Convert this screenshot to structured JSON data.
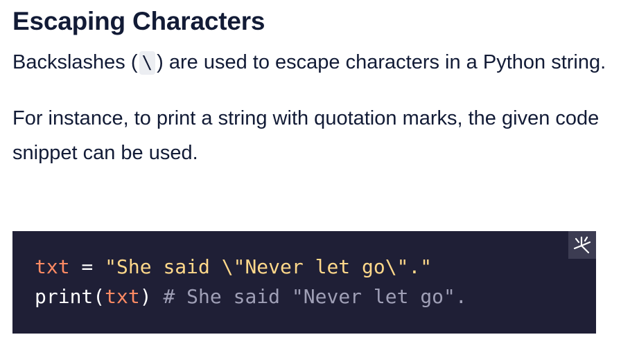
{
  "article": {
    "title": "Escaping Characters",
    "para1_before": "Backslashes (",
    "para1_code": "\\",
    "para1_after": ") are used to escape characters in a Python string.",
    "para2": "For instance, to print a string with quotation marks, the given code snippet can be used."
  },
  "code": {
    "line1": {
      "var": "txt",
      "op": " = ",
      "str": "\"She said \\\"Never let go\\\".\""
    },
    "line2": {
      "fn": "print(",
      "arg": "txt",
      "close": ") ",
      "comment": "# She said \"Never let go\"."
    }
  },
  "colors": {
    "code_bg": "#1f1f36",
    "variable": "#ff8a63",
    "string": "#ffd88a",
    "comment": "#9f9fb6"
  },
  "icons": {
    "run": "sparkle-icon"
  }
}
